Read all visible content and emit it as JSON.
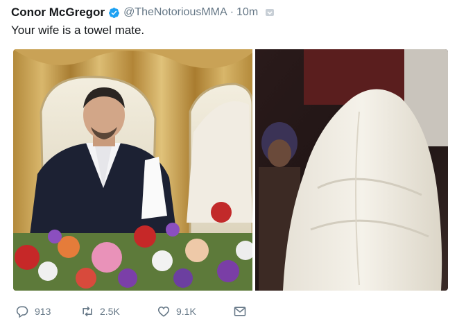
{
  "tweet": {
    "author_name": "Conor McGregor",
    "verified_icon": "verified-badge-icon",
    "handle": "@TheNotoriousMMA",
    "separator": "·",
    "timestamp": "10m",
    "text": "Your wife is a towel mate."
  },
  "media": {
    "photo_count": 2
  },
  "actions": {
    "reply": {
      "icon": "reply-icon",
      "count": "913"
    },
    "retweet": {
      "icon": "retweet-icon",
      "count": "2.5K"
    },
    "like": {
      "icon": "heart-icon",
      "count": "9.1K"
    },
    "dm": {
      "icon": "envelope-icon"
    }
  },
  "colors": {
    "text_primary": "#14171a",
    "text_secondary": "#657786",
    "verified_blue": "#1da1f2"
  }
}
